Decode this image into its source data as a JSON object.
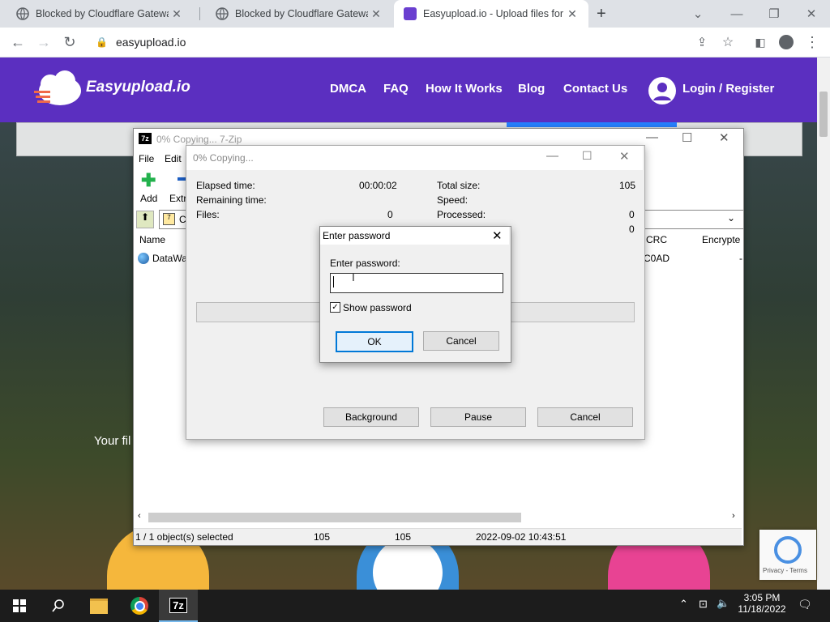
{
  "browser": {
    "tabs": [
      {
        "title": "Blocked by Cloudflare Gateway",
        "active": false
      },
      {
        "title": "Blocked by Cloudflare Gateway",
        "active": false
      },
      {
        "title": "Easyupload.io - Upload files for f",
        "active": true
      }
    ],
    "new_tab_icon": "+",
    "url": "easyupload.io"
  },
  "site": {
    "logo": "Easyupload.io",
    "nav": [
      "DMCA",
      "FAQ",
      "How It Works",
      "Blog",
      "Contact Us"
    ],
    "login": "Login / Register",
    "your_files_text": "Your fil",
    "recaptcha": "Privacy - Terms"
  },
  "zip": {
    "title": "0% Copying... 7-Zip",
    "menu": [
      "File",
      "Edit"
    ],
    "toolbar": [
      "Add",
      "Extr"
    ],
    "path_fragment": "C",
    "columns": {
      "name": "Name",
      "crc": "CRC",
      "encrypted": "Encrypte"
    },
    "row": {
      "name": "DataWa",
      "crc": "C0AD",
      "encrypted": "-"
    },
    "status": {
      "selected": "1 / 1 object(s) selected",
      "size": "105",
      "packed": "105",
      "modified": "2022-09-02 10:43:51"
    }
  },
  "copy": {
    "title": "0% Copying...",
    "elapsed_label": "Elapsed time:",
    "elapsed_value": "00:00:02",
    "remaining_label": "Remaining time:",
    "files_label": "Files:",
    "files_value": "0",
    "total_label": "Total size:",
    "total_value": "105",
    "speed_label": "Speed:",
    "processed_label": "Processed:",
    "processed_value": "0",
    "extra_value": "0",
    "background": "Background",
    "pause": "Pause",
    "cancel": "Cancel"
  },
  "password": {
    "title": "Enter password",
    "label": "Enter password:",
    "value": "",
    "show_label": "Show password",
    "show_checked": "✓",
    "ok": "OK",
    "cancel": "Cancel"
  },
  "taskbar": {
    "time": "3:05 PM",
    "date": "11/18/2022",
    "app_7z": "7z"
  }
}
